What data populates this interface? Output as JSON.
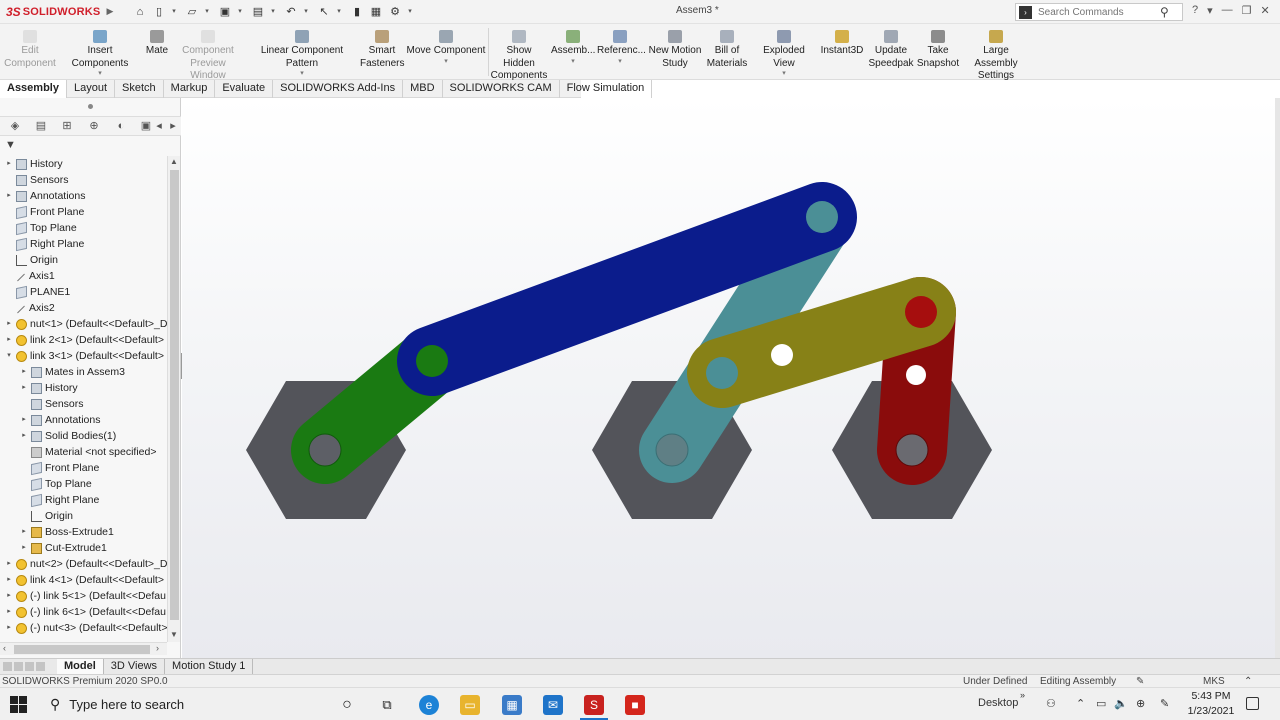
{
  "app": {
    "logo_ds": "3S",
    "logo_name": "SOLIDWORKS",
    "doc_title": "Assem3 *"
  },
  "search": {
    "placeholder": "Search Commands"
  },
  "title_controls": [
    "?",
    "▾",
    "—",
    "❐",
    "✕"
  ],
  "commands": [
    {
      "label": "Edit\nComponent",
      "disabled": true
    },
    {
      "label": "Insert Components"
    },
    {
      "label": "Mate"
    },
    {
      "label": "Component\nPreview Window",
      "disabled": true
    },
    {
      "label": "Linear Component Pattern"
    },
    {
      "label": "Smart\nFasteners"
    },
    {
      "label": "Move Component"
    },
    {
      "label": "Show Hidden\nComponents"
    },
    {
      "label": "Assemb..."
    },
    {
      "label": "Referenc..."
    },
    {
      "label": "New Motion\nStudy"
    },
    {
      "label": "Bill of\nMaterials"
    },
    {
      "label": "Exploded View"
    },
    {
      "label": "Instant3D"
    },
    {
      "label": "Update\nSpeedpak"
    },
    {
      "label": "Take\nSnapshot"
    },
    {
      "label": "Large Assembly\nSettings"
    }
  ],
  "tabs": [
    "Assembly",
    "Layout",
    "Sketch",
    "Markup",
    "Evaluate",
    "SOLIDWORKS Add-Ins",
    "MBD",
    "SOLIDWORKS CAM",
    "Flow Simulation"
  ],
  "tree": [
    {
      "label": "History",
      "icon": "folder-icon",
      "level": 0,
      "exp": "▸"
    },
    {
      "label": "Sensors",
      "icon": "folder-icon",
      "level": 0,
      "exp": ""
    },
    {
      "label": "Annotations",
      "icon": "folder-icon",
      "level": 0,
      "exp": "▸"
    },
    {
      "label": "Front Plane",
      "icon": "plane-icon",
      "level": 0,
      "exp": ""
    },
    {
      "label": "Top Plane",
      "icon": "plane-icon",
      "level": 0,
      "exp": ""
    },
    {
      "label": "Right Plane",
      "icon": "plane-icon",
      "level": 0,
      "exp": ""
    },
    {
      "label": "Origin",
      "icon": "origin-icon",
      "level": 0,
      "exp": ""
    },
    {
      "label": "Axis1",
      "icon": "axis-icon",
      "level": 0,
      "exp": ""
    },
    {
      "label": "PLANE1",
      "icon": "plane-icon",
      "level": 0,
      "exp": ""
    },
    {
      "label": "Axis2",
      "icon": "axis-icon",
      "level": 0,
      "exp": ""
    },
    {
      "label": "nut<1> (Default<<Default>_D",
      "icon": "part-icon",
      "level": 0,
      "exp": "▸"
    },
    {
      "label": "link 2<1> (Default<<Default>",
      "icon": "part-icon",
      "level": 0,
      "exp": "▸"
    },
    {
      "label": "link 3<1> (Default<<Default>",
      "icon": "part-icon",
      "level": 0,
      "exp": "▾"
    },
    {
      "label": "Mates in Assem3",
      "icon": "folder-icon",
      "level": 1,
      "exp": "▸"
    },
    {
      "label": "History",
      "icon": "folder-icon",
      "level": 1,
      "exp": "▸"
    },
    {
      "label": "Sensors",
      "icon": "folder-icon",
      "level": 1,
      "exp": ""
    },
    {
      "label": "Annotations",
      "icon": "folder-icon",
      "level": 1,
      "exp": "▸"
    },
    {
      "label": "Solid Bodies(1)",
      "icon": "folder-icon",
      "level": 1,
      "exp": "▸"
    },
    {
      "label": "Material <not specified>",
      "icon": "material-icon",
      "level": 1,
      "exp": ""
    },
    {
      "label": "Front Plane",
      "icon": "plane-icon",
      "level": 1,
      "exp": ""
    },
    {
      "label": "Top Plane",
      "icon": "plane-icon",
      "level": 1,
      "exp": ""
    },
    {
      "label": "Right Plane",
      "icon": "plane-icon",
      "level": 1,
      "exp": ""
    },
    {
      "label": "Origin",
      "icon": "origin-icon",
      "level": 1,
      "exp": ""
    },
    {
      "label": "Boss-Extrude1",
      "icon": "feature-icon",
      "level": 1,
      "exp": "▸"
    },
    {
      "label": "Cut-Extrude1",
      "icon": "feature-icon",
      "level": 1,
      "exp": "▸"
    },
    {
      "label": "nut<2> (Default<<Default>_D",
      "icon": "part-icon",
      "level": 0,
      "exp": "▸"
    },
    {
      "label": "link 4<1> (Default<<Default>",
      "icon": "part-icon",
      "level": 0,
      "exp": "▸"
    },
    {
      "label": "(-) link 5<1> (Default<<Defau",
      "icon": "part-icon",
      "level": 0,
      "exp": "▸"
    },
    {
      "label": "(-) link 6<1> (Default<<Defau",
      "icon": "part-icon",
      "level": 0,
      "exp": "▸"
    },
    {
      "label": "(-) nut<3> (Default<<Default>",
      "icon": "part-icon",
      "level": 0,
      "exp": "▸"
    }
  ],
  "bottom_tabs": [
    "Model",
    "3D Views",
    "Motion Study 1"
  ],
  "status": {
    "version": "SOLIDWORKS Premium 2020 SP0.0",
    "state": "Under Defined",
    "mode": "Editing Assembly",
    "units": "MKS"
  },
  "taskbar": {
    "search_text": "Type here to search",
    "desktop_label": "Desktop",
    "time": "5:43 PM",
    "date": "1/23/2021"
  },
  "colors": {
    "nut": "#53545a",
    "link_green": "#1a7a12",
    "link_blue": "#0b1c8c",
    "link_teal": "#4b8f96",
    "link_olive": "#878117",
    "link_red": "#8a0c0c"
  }
}
